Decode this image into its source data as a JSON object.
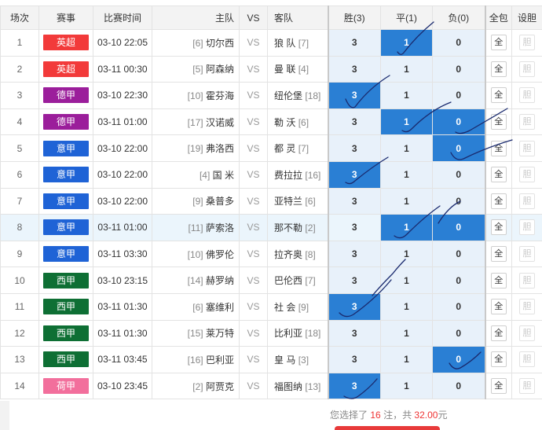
{
  "headers": {
    "no": "场次",
    "league": "赛事",
    "time": "比赛时间",
    "home": "主队",
    "vs": "VS",
    "away": "客队",
    "win": "胜(3)",
    "draw": "平(1)",
    "lose": "负(0)",
    "all": "全包",
    "dan": "设胆"
  },
  "colors": {
    "英超": "#f23a3a",
    "德甲": "#9b1e9b",
    "意甲": "#1f63d6",
    "西甲": "#0e6f34",
    "荷甲": "#f26f9c",
    "selected": "#2a7fd4"
  },
  "rows": [
    {
      "no": "1",
      "league": "英超",
      "time": "03-10 22:05",
      "home_rank": "[6]",
      "home": "切尔西",
      "vs": "VS",
      "away": "狼 队",
      "away_rank": "[7]",
      "win": "3",
      "draw": "1",
      "lose": "0",
      "sel": [
        false,
        true,
        false
      ],
      "all": "全",
      "dan": "胆"
    },
    {
      "no": "2",
      "league": "英超",
      "time": "03-11 00:30",
      "home_rank": "[5]",
      "home": "阿森纳",
      "vs": "VS",
      "away": "曼 联",
      "away_rank": "[4]",
      "win": "3",
      "draw": "1",
      "lose": "0",
      "sel": [
        false,
        false,
        false
      ],
      "all": "全",
      "dan": "胆"
    },
    {
      "no": "3",
      "league": "德甲",
      "time": "03-10 22:30",
      "home_rank": "[10]",
      "home": "霍芬海",
      "vs": "VS",
      "away": "纽伦堡",
      "away_rank": "[18]",
      "win": "3",
      "draw": "1",
      "lose": "0",
      "sel": [
        true,
        false,
        false
      ],
      "all": "全",
      "dan": "胆"
    },
    {
      "no": "4",
      "league": "德甲",
      "time": "03-11 01:00",
      "home_rank": "[17]",
      "home": "汉诺威",
      "vs": "VS",
      "away": "勒 沃",
      "away_rank": "[6]",
      "win": "3",
      "draw": "1",
      "lose": "0",
      "sel": [
        false,
        true,
        true
      ],
      "all": "全",
      "dan": "胆"
    },
    {
      "no": "5",
      "league": "意甲",
      "time": "03-10 22:00",
      "home_rank": "[19]",
      "home": "弗洛西",
      "vs": "VS",
      "away": "都 灵",
      "away_rank": "[7]",
      "win": "3",
      "draw": "1",
      "lose": "0",
      "sel": [
        false,
        false,
        true
      ],
      "all": "全",
      "dan": "胆"
    },
    {
      "no": "6",
      "league": "意甲",
      "time": "03-10 22:00",
      "home_rank": "[4]",
      "home": "国 米",
      "vs": "VS",
      "away": "费拉拉",
      "away_rank": "[16]",
      "win": "3",
      "draw": "1",
      "lose": "0",
      "sel": [
        true,
        false,
        false
      ],
      "all": "全",
      "dan": "胆"
    },
    {
      "no": "7",
      "league": "意甲",
      "time": "03-10 22:00",
      "home_rank": "[9]",
      "home": "桑普多",
      "vs": "VS",
      "away": "亚特兰",
      "away_rank": "[6]",
      "win": "3",
      "draw": "1",
      "lose": "0",
      "sel": [
        false,
        false,
        false
      ],
      "all": "全",
      "dan": "胆"
    },
    {
      "no": "8",
      "league": "意甲",
      "time": "03-11 01:00",
      "home_rank": "[11]",
      "home": "萨索洛",
      "vs": "VS",
      "away": "那不勒",
      "away_rank": "[2]",
      "win": "3",
      "draw": "1",
      "lose": "0",
      "sel": [
        false,
        true,
        true
      ],
      "all": "全",
      "dan": "胆",
      "hl": true
    },
    {
      "no": "9",
      "league": "意甲",
      "time": "03-11 03:30",
      "home_rank": "[10]",
      "home": "佛罗伦",
      "vs": "VS",
      "away": "拉齐奥",
      "away_rank": "[8]",
      "win": "3",
      "draw": "1",
      "lose": "0",
      "sel": [
        false,
        false,
        false
      ],
      "all": "全",
      "dan": "胆"
    },
    {
      "no": "10",
      "league": "西甲",
      "time": "03-10 23:15",
      "home_rank": "[14]",
      "home": "赫罗纳",
      "vs": "VS",
      "away": "巴伦西",
      "away_rank": "[7]",
      "win": "3",
      "draw": "1",
      "lose": "0",
      "sel": [
        false,
        false,
        false
      ],
      "all": "全",
      "dan": "胆"
    },
    {
      "no": "11",
      "league": "西甲",
      "time": "03-11 01:30",
      "home_rank": "[6]",
      "home": "塞维利",
      "vs": "VS",
      "away": "社 会",
      "away_rank": "[9]",
      "win": "3",
      "draw": "1",
      "lose": "0",
      "sel": [
        true,
        false,
        false
      ],
      "all": "全",
      "dan": "胆"
    },
    {
      "no": "12",
      "league": "西甲",
      "time": "03-11 01:30",
      "home_rank": "[15]",
      "home": "莱万特",
      "vs": "VS",
      "away": "比利亚",
      "away_rank": "[18]",
      "win": "3",
      "draw": "1",
      "lose": "0",
      "sel": [
        false,
        false,
        false
      ],
      "all": "全",
      "dan": "胆"
    },
    {
      "no": "13",
      "league": "西甲",
      "time": "03-11 03:45",
      "home_rank": "[16]",
      "home": "巴利亚",
      "vs": "VS",
      "away": "皇 马",
      "away_rank": "[3]",
      "win": "3",
      "draw": "1",
      "lose": "0",
      "sel": [
        false,
        false,
        true
      ],
      "all": "全",
      "dan": "胆"
    },
    {
      "no": "14",
      "league": "荷甲",
      "time": "03-10 23:45",
      "home_rank": "[2]",
      "home": "阿贾克",
      "vs": "VS",
      "away": "福图纳",
      "away_rank": "[13]",
      "win": "3",
      "draw": "1",
      "lose": "0",
      "sel": [
        true,
        false,
        false
      ],
      "all": "全",
      "dan": "胆"
    }
  ],
  "summary": {
    "prefix": "您选择了",
    "count": "16",
    "mid": "注，共",
    "amount": "32.00",
    "suffix": "元"
  }
}
